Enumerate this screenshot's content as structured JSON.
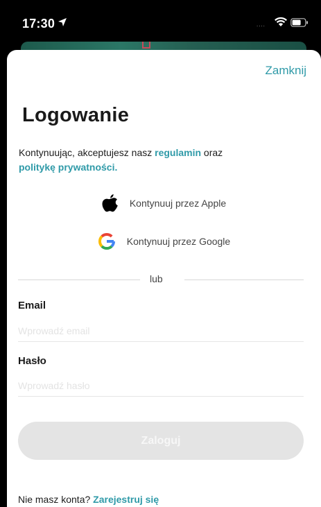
{
  "status_bar": {
    "time": "17:30",
    "signal": "....",
    "icons": [
      "location-arrow-icon",
      "wifi-icon",
      "battery-icon"
    ]
  },
  "header": {
    "close_label": "Zamknij"
  },
  "main": {
    "title": "Logowanie",
    "terms": {
      "prefix": "Kontynuując, akceptujesz nasz ",
      "terms_link": "regulamin",
      "middle": " oraz ",
      "privacy_link": "politykę prywatności."
    },
    "social": {
      "apple_label": "Kontynuuj przez Apple",
      "google_label": "Kontynuuj przez Google"
    },
    "divider_label": "lub",
    "email": {
      "label": "Email",
      "placeholder": "Wprowadź email",
      "value": ""
    },
    "password": {
      "label": "Hasło",
      "placeholder": "Wprowadź hasło",
      "value": ""
    },
    "login_label": "Zaloguj",
    "register": {
      "prefix": "Nie masz konta? ",
      "link": "Zarejestruj się"
    }
  },
  "colors": {
    "accent": "#2f9aa8",
    "disabled_button": "#e4e4e4",
    "text": "#1a1a1a"
  }
}
